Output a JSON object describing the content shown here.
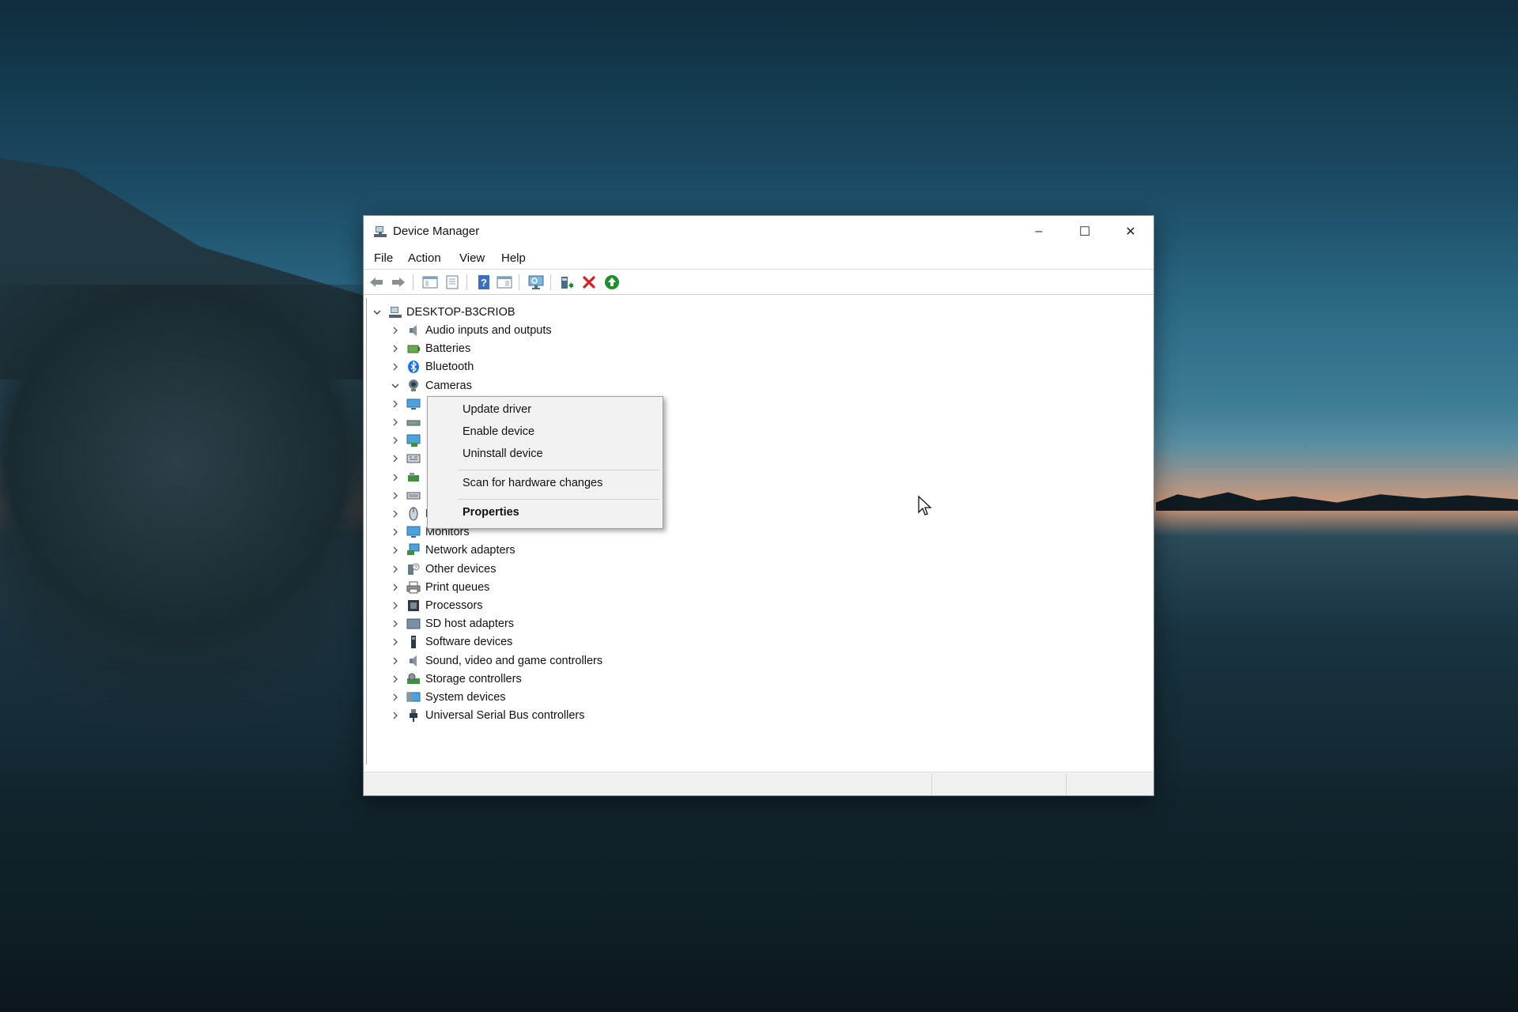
{
  "window": {
    "title": "Device Manager",
    "controls": {
      "minimize": "–",
      "maximize": "☐",
      "close": "✕"
    }
  },
  "menubar": [
    "File",
    "Action",
    "View",
    "Help"
  ],
  "toolbar": [
    {
      "icon": "back-arrow-icon"
    },
    {
      "icon": "forward-arrow-icon"
    },
    {
      "icon": "show-hide-console-tree-icon"
    },
    {
      "icon": "properties-icon"
    },
    {
      "icon": "help-icon"
    },
    {
      "icon": "action-pane-icon"
    },
    {
      "icon": "scan-hardware-monitor-icon"
    },
    {
      "icon": "update-driver-icon"
    },
    {
      "icon": "uninstall-x-icon"
    },
    {
      "icon": "enable-device-up-arrow-icon"
    }
  ],
  "tree": {
    "root": "DESKTOP-B3CRIOB",
    "items": [
      {
        "label": "Audio inputs and outputs",
        "icon": "speaker-icon",
        "expanded": false
      },
      {
        "label": "Batteries",
        "icon": "battery-icon",
        "expanded": false
      },
      {
        "label": "Bluetooth",
        "icon": "bluetooth-icon",
        "expanded": false
      },
      {
        "label": "Cameras",
        "icon": "camera-icon",
        "expanded": true
      },
      {
        "label": "",
        "icon": "computer-icon",
        "expanded": false
      },
      {
        "label": "",
        "icon": "disk-drive-icon",
        "expanded": false
      },
      {
        "label": "",
        "icon": "display-adapter-icon",
        "expanded": false
      },
      {
        "label": "",
        "icon": "hid-icon",
        "expanded": false
      },
      {
        "label": "",
        "icon": "ide-controller-icon",
        "expanded": false
      },
      {
        "label": "",
        "icon": "keyboard-icon",
        "expanded": false
      },
      {
        "label": "Mice and other pointing devices",
        "icon": "mouse-icon",
        "expanded": false
      },
      {
        "label": "Monitors",
        "icon": "monitor-icon",
        "expanded": false
      },
      {
        "label": "Network adapters",
        "icon": "network-adapter-icon",
        "expanded": false
      },
      {
        "label": "Other devices",
        "icon": "other-devices-icon",
        "expanded": false
      },
      {
        "label": "Print queues",
        "icon": "printer-icon",
        "expanded": false
      },
      {
        "label": "Processors",
        "icon": "processor-icon",
        "expanded": false
      },
      {
        "label": "SD host adapters",
        "icon": "sd-card-icon",
        "expanded": false
      },
      {
        "label": "Software devices",
        "icon": "software-device-icon",
        "expanded": false
      },
      {
        "label": "Sound, video and game controllers",
        "icon": "speaker-icon",
        "expanded": false
      },
      {
        "label": "Storage controllers",
        "icon": "storage-controller-icon",
        "expanded": false
      },
      {
        "label": "System devices",
        "icon": "system-devices-icon",
        "expanded": false
      },
      {
        "label": "Universal Serial Bus controllers",
        "icon": "usb-icon",
        "expanded": false
      }
    ]
  },
  "context_menu": {
    "items": [
      {
        "label": "Update driver",
        "bold": false
      },
      {
        "label": "Enable device",
        "bold": false
      },
      {
        "label": "Uninstall device",
        "bold": false
      },
      {
        "label": "Scan for hardware changes",
        "bold": false
      },
      {
        "label": "Properties",
        "bold": true
      }
    ]
  },
  "colors": {
    "accent_blue": "#1a73e8",
    "uninstall_red": "#d81e1e",
    "enable_green": "#1e8f2e"
  }
}
